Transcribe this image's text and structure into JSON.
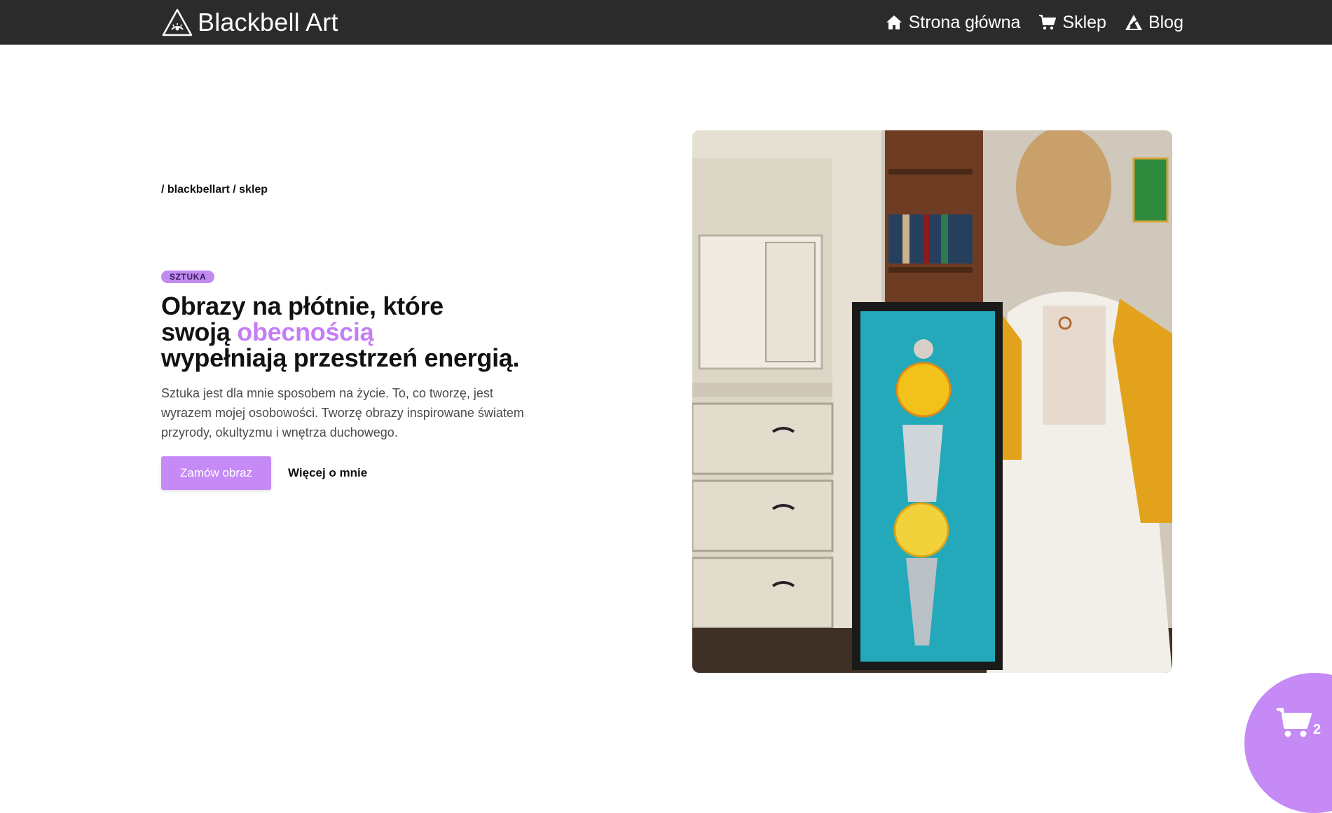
{
  "header": {
    "brand_name": "Blackbell Art",
    "nav": [
      {
        "label": "Strona główna",
        "icon": "home-icon"
      },
      {
        "label": "Sklep",
        "icon": "cart-icon"
      },
      {
        "label": "Blog",
        "icon": "blog-icon"
      }
    ]
  },
  "hero": {
    "breadcrumb": "/ blackbellart / sklep",
    "badge": "SZTUKA",
    "headline": {
      "line1": "Obrazy na płótnie, które",
      "line2_before": "swoją ",
      "line2_highlight": "obecnością",
      "line3": "wypełniają przestrzeń energią."
    },
    "description": "Sztuka jest dla mnie sposobem na życie. To, co tworzę, jest wyrazem mojej osobowości. Tworzę obrazy inspirowane światem przyrody, okultyzmu i wnętrza duchowego.",
    "primary_button": "Zamów obraz",
    "secondary_link": "Więcej o mnie",
    "image_icon": "artist-with-painting-photo"
  },
  "cart": {
    "count": "2",
    "icon": "shopping-cart-icon"
  },
  "colors": {
    "nav_bg": "#2b2b2b",
    "accent": "#c58af5",
    "headline_highlight": "#c47ef5",
    "text": "#121212"
  }
}
